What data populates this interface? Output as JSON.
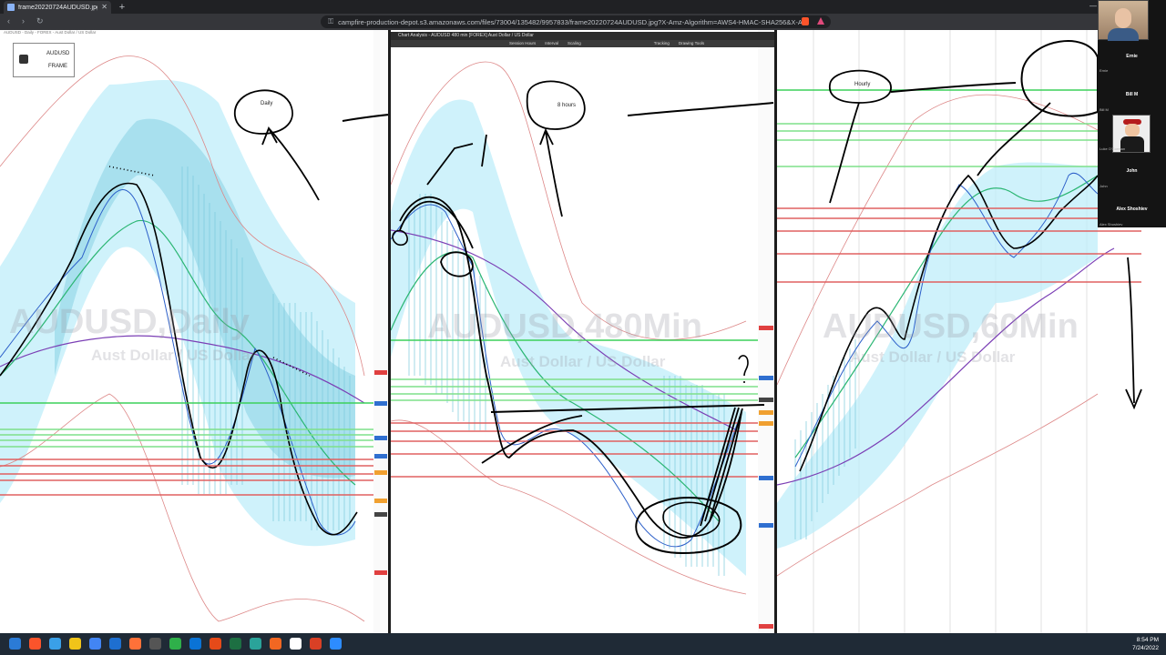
{
  "browser": {
    "tab_title": "frame20220724AUDUSD.jpg (38…",
    "tab_close": "✕",
    "new_tab": "+",
    "minimize": "—",
    "nav_back": "‹",
    "nav_forward": "›",
    "nav_reload": "↻",
    "lock_icon": "⚿",
    "url": "campfire-production-depot.s3.amazonaws.com/files/73004/135482/9957833/frame20220724AUDUSD.jpg?X-Amz-Algorithm=AWS4-HMAC-SHA256&X-A…"
  },
  "panels": {
    "daily": {
      "watermark": "AUDUSD,Daily",
      "sub_watermark": "Aust Dollar / US Dollar",
      "legend_line1": "AUDUSD",
      "legend_line2": "FRAME",
      "annotation": "Daily"
    },
    "h8": {
      "window_title": "Chart Analysis - AUDUSD 480 min [FOREX] Aust Dollar / US Dollar",
      "toolbar": [
        "Session Hours",
        "Interval",
        "Scaling",
        "Tracking",
        "Drawing Tools"
      ],
      "watermark": "AUDUSD,480Min",
      "sub_watermark": "Aust Dollar / US Dollar",
      "annotation": "8 hours"
    },
    "h1": {
      "watermark": "AUDUSD,60Min",
      "sub_watermark": "Aust Dollar / US Dollar",
      "annotation": "Hourly"
    }
  },
  "video_call": {
    "participants": [
      {
        "name": "Ernie"
      },
      {
        "name": "Bill M"
      },
      {
        "name": "John"
      },
      {
        "name": "Alex Shoshiev"
      }
    ],
    "small_labels": [
      "Ernie",
      "Bill M",
      "Luke O'Gorman",
      "John",
      "Alex Shoshiev"
    ]
  },
  "taskbar": {
    "time": "8:54 PM",
    "date": "7/24/2022",
    "app_colors": [
      "#2b7bd6",
      "#fb542b",
      "#3aa0e8",
      "#f0c419",
      "#4285f4",
      "#1e6fd0",
      "#ff7139",
      "#555555",
      "#2fb04a",
      "#0a73d6",
      "#e64a19",
      "#1d6f42",
      "#2aa39a",
      "#f26722",
      "#ffffff",
      "#d94025",
      "#2d8cff"
    ]
  }
}
